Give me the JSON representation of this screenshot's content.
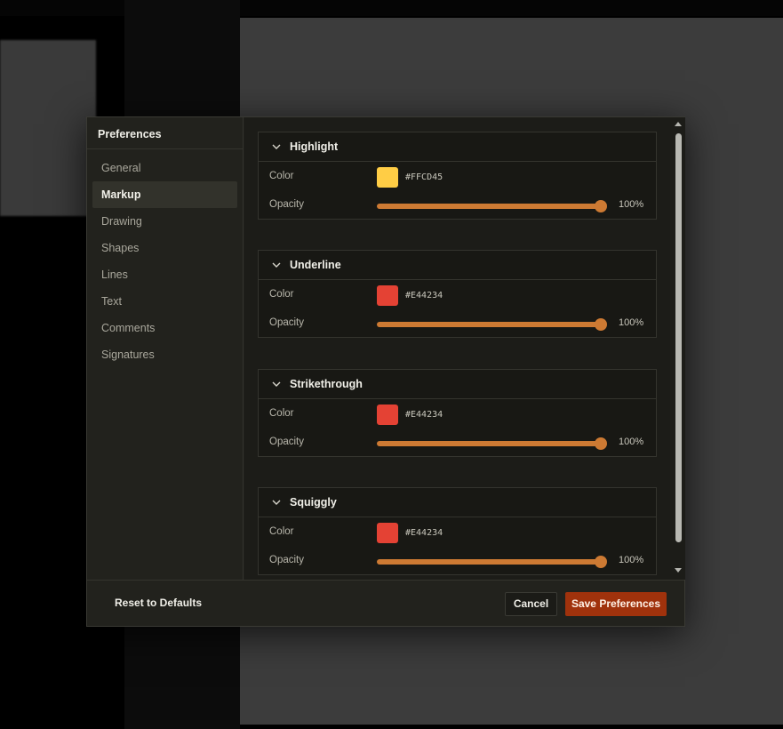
{
  "dialog": {
    "title": "Preferences",
    "nav": [
      {
        "label": "General",
        "active": false
      },
      {
        "label": "Markup",
        "active": true
      },
      {
        "label": "Drawing",
        "active": false
      },
      {
        "label": "Shapes",
        "active": false
      },
      {
        "label": "Lines",
        "active": false
      },
      {
        "label": "Text",
        "active": false
      },
      {
        "label": "Comments",
        "active": false
      },
      {
        "label": "Signatures",
        "active": false
      }
    ],
    "sections": [
      {
        "title": "Highlight",
        "color_label": "Color",
        "color": "#FFCD45",
        "hex": "#FFCD45",
        "opacity_label": "Opacity",
        "opacity": 1.0,
        "opacity_text": "100%"
      },
      {
        "title": "Underline",
        "color_label": "Color",
        "color": "#E44234",
        "hex": "#E44234",
        "opacity_label": "Opacity",
        "opacity": 1.0,
        "opacity_text": "100%"
      },
      {
        "title": "Strikethrough",
        "color_label": "Color",
        "color": "#E44234",
        "hex": "#E44234",
        "opacity_label": "Opacity",
        "opacity": 1.0,
        "opacity_text": "100%"
      },
      {
        "title": "Squiggly",
        "color_label": "Color",
        "color": "#E44234",
        "hex": "#E44234",
        "opacity_label": "Opacity",
        "opacity": 1.0,
        "opacity_text": "100%"
      }
    ],
    "footer": {
      "reset_label": "Reset to Defaults",
      "cancel_label": "Cancel",
      "save_label": "Save Preferences"
    },
    "colors": {
      "accent": "#CD7A33",
      "primary_button": "#A0320C"
    }
  }
}
